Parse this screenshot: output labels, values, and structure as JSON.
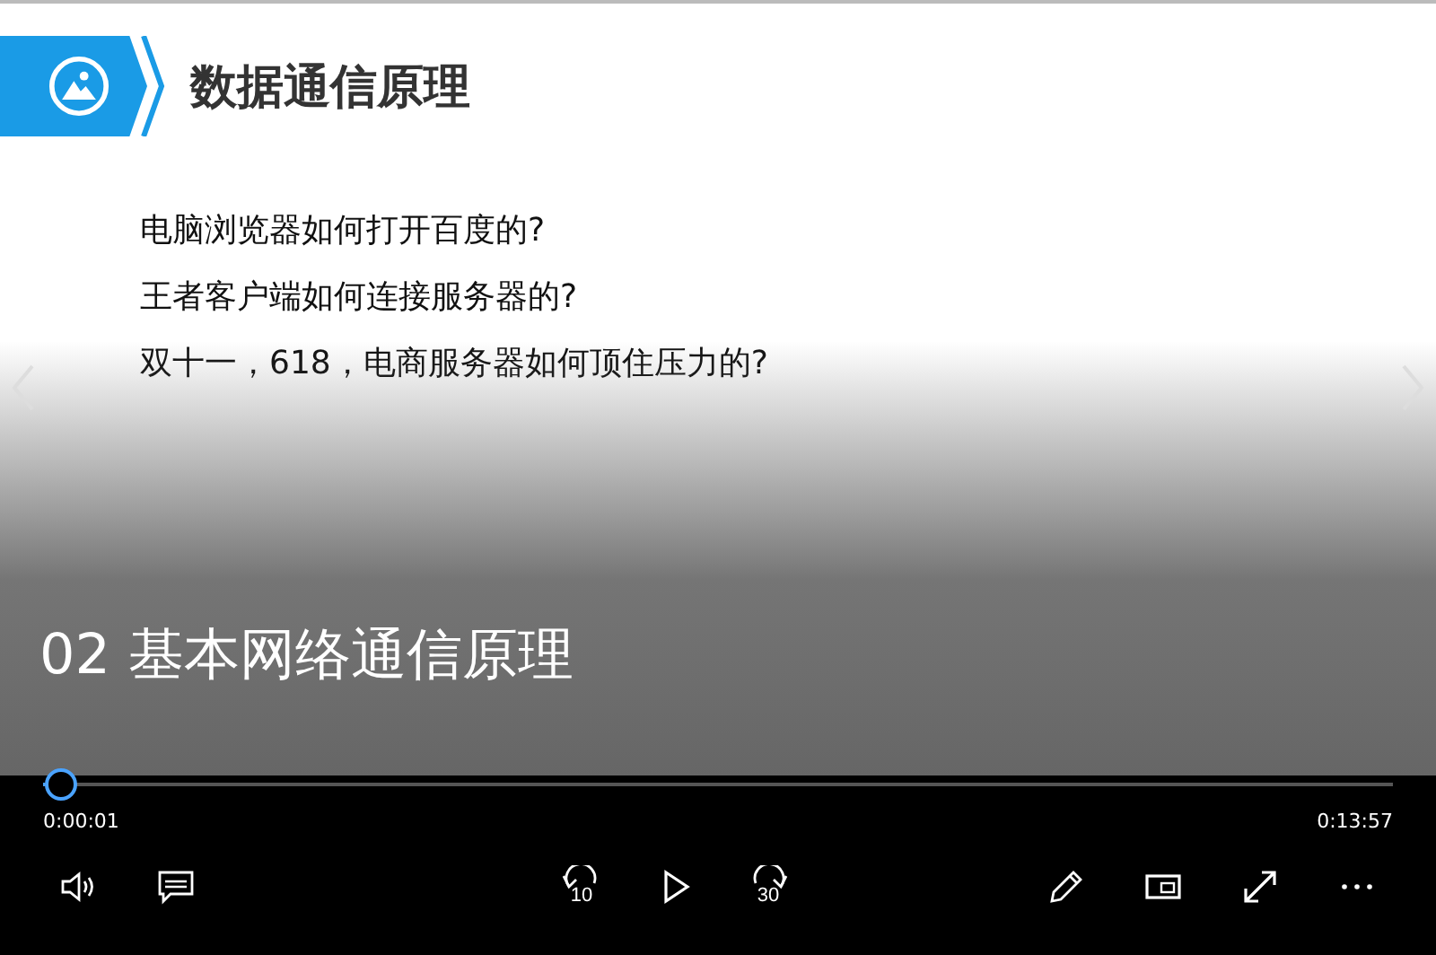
{
  "slide": {
    "title": "数据通信原理",
    "questions": [
      "电脑浏览器如何打开百度的?",
      "王者客户端如何连接服务器的?",
      "双十一，618，电商服务器如何顶住压力的?"
    ]
  },
  "chapter_title": "02 基本网络通信原理",
  "player": {
    "progress": {
      "level": 0.0012
    },
    "elapsed": "0:00:01",
    "duration": "0:13:57",
    "playing": false,
    "skip_back_label": "10",
    "skip_forward_label": "30"
  }
}
